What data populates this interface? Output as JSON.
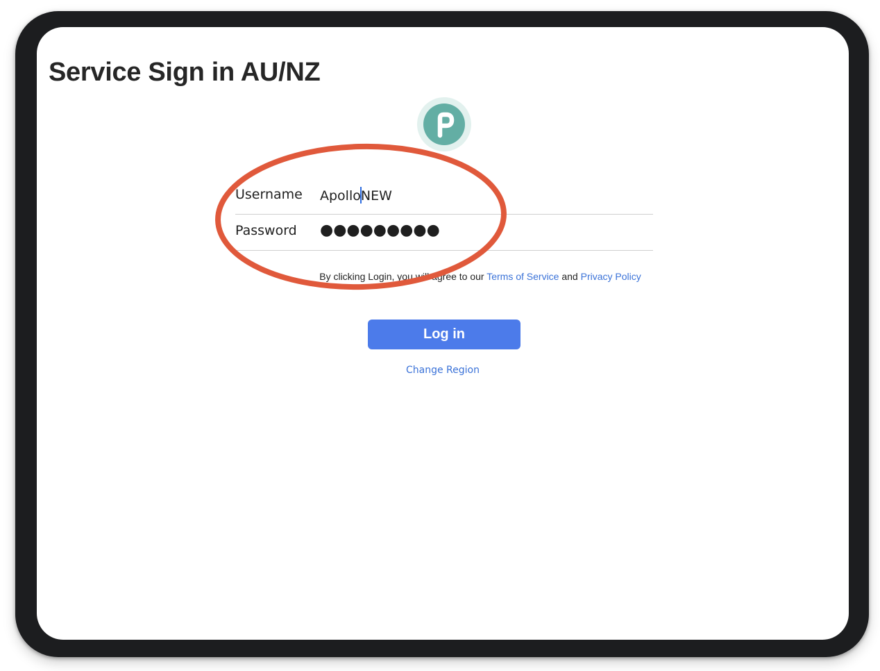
{
  "page": {
    "title": "Service Sign in AU/NZ"
  },
  "logo": {
    "letter": "P",
    "icon": "app-logo-icon",
    "color": "#63aea4",
    "ring_color": "#e2f1ee"
  },
  "form": {
    "username": {
      "label": "Username",
      "value_before_caret": "Apollo",
      "value_after_caret": "NEW"
    },
    "password": {
      "label": "Password",
      "value": "●●●●●●●●●"
    }
  },
  "terms": {
    "prefix": "By clicking Login, you will agree to our ",
    "terms_link": "Terms of Service",
    "middle": " and ",
    "privacy_link": "Privacy Policy"
  },
  "actions": {
    "login_label": "Log in",
    "change_region_label": "Change Region"
  },
  "colors": {
    "accent": "#4c7bea",
    "link": "#3a72d8",
    "annotation": "#e0593b"
  },
  "annotation": {
    "shape": "ellipse",
    "target": "username and password fields"
  }
}
